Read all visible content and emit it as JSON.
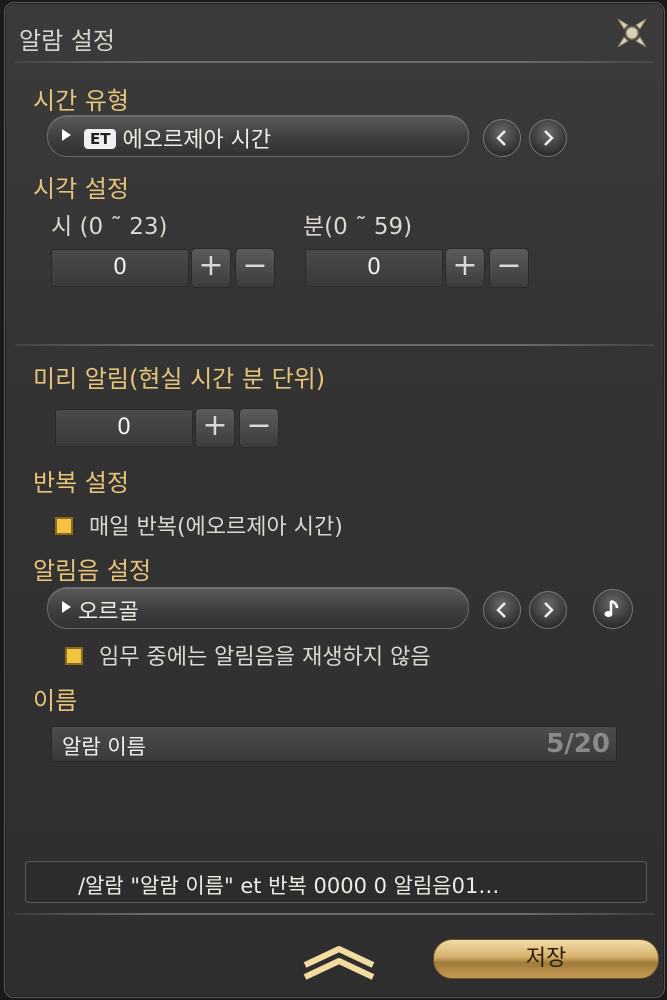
{
  "window": {
    "title": "알람 설정"
  },
  "time_type": {
    "heading": "시간 유형",
    "badge": "ET",
    "selected": "에오르제아 시간"
  },
  "time_set": {
    "heading": "시각 설정",
    "hour_label": "시 (0 ˜ 23)",
    "hour_value": "0",
    "minute_label": "분(0 ˜ 59)",
    "minute_value": "0"
  },
  "pre_alarm": {
    "heading": "미리 알림(현실 시간 분 단위)",
    "value": "0"
  },
  "repeat": {
    "heading": "반복 설정",
    "daily_label": "매일 반복(에오르제아 시간)",
    "daily_checked": true
  },
  "sound": {
    "heading": "알림음 설정",
    "selected": "오르골",
    "mute_in_duty_label": "임무 중에는 알림음을 재생하지 않음",
    "mute_in_duty_checked": true
  },
  "name": {
    "heading": "이름",
    "value": "알람 이름",
    "counter": "5/20"
  },
  "command": {
    "text": "/알람 \"알람 이름\" et 반복 0000 0 알림음01…"
  },
  "buttons": {
    "plus": "+",
    "minus": "−",
    "save": "저장"
  },
  "colors": {
    "heading": "#e6c27a",
    "checkbox": "#f4c342",
    "save": "#d6b06a"
  }
}
